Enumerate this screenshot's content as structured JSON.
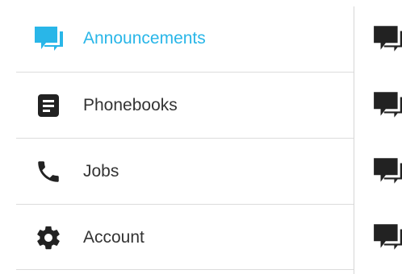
{
  "colors": {
    "accent": "#29b6e8",
    "text": "#333333",
    "icon_dark": "#222222",
    "divider": "#dcdcdc"
  },
  "menu": {
    "items": [
      {
        "label": "Announcements",
        "icon": "chat-bubble-icon",
        "active": true
      },
      {
        "label": "Phonebooks",
        "icon": "document-icon",
        "active": false
      },
      {
        "label": "Jobs",
        "icon": "phone-icon",
        "active": false
      },
      {
        "label": "Account",
        "icon": "gear-icon",
        "active": false
      }
    ]
  },
  "right_pane": {
    "icons": [
      "chat-bubble-icon",
      "chat-bubble-icon",
      "chat-bubble-icon",
      "chat-bubble-icon"
    ]
  }
}
